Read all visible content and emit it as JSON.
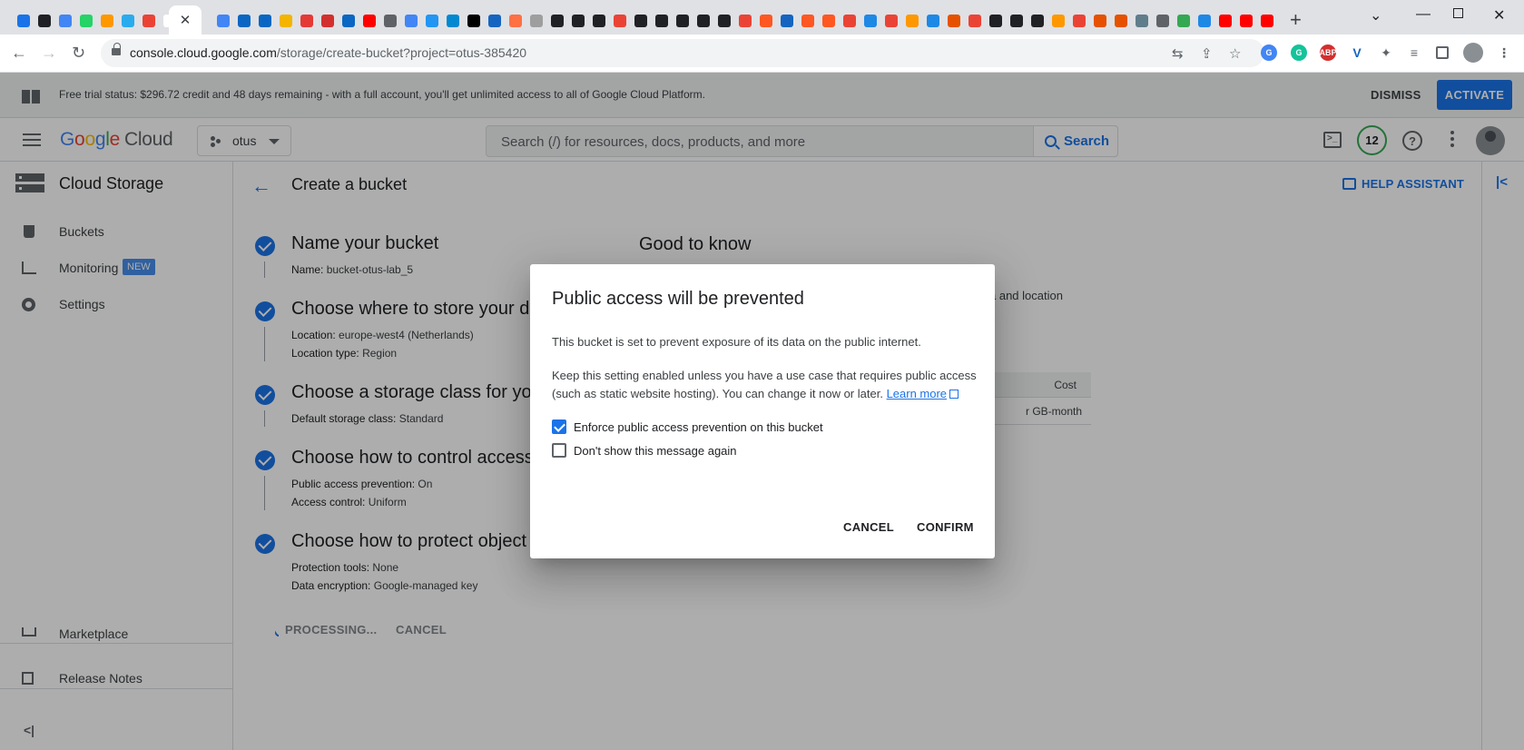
{
  "browser": {
    "active_tab_close": "✕",
    "new_tab": "+",
    "url_host": "console.cloud.google.com",
    "url_path": "/storage/create-bucket?project=otus-385420",
    "favicon_colors": [
      "#1a73e8",
      "#202124",
      "#4285f4",
      "#25d366",
      "#ff9800",
      "#2aabee",
      "#ea4335",
      "#ffffff",
      "#4285f4",
      "#0a66c2",
      "#0a66c2",
      "#f4b400",
      "#e53935",
      "#d32f2f",
      "#0a66c2",
      "#ff0000",
      "#5f6368",
      "#4285f4",
      "#2196f3",
      "#0288d1",
      "#000000",
      "#1565c0",
      "#ff7043",
      "#9e9e9e",
      "#202124",
      "#202124",
      "#202124",
      "#ea4335",
      "#202124",
      "#202124",
      "#202124",
      "#202124",
      "#202124",
      "#ea4335",
      "#ff5722",
      "#1565c0",
      "#ff5722",
      "#ff5722",
      "#ea4335",
      "#1e88e5",
      "#ea4335",
      "#ff9800",
      "#1e88e5",
      "#e65100",
      "#ea4335",
      "#202124",
      "#202124",
      "#202124",
      "#ff9800",
      "#ea4335",
      "#e65100",
      "#e65100",
      "#607d8b",
      "#5f6368",
      "#34a853",
      "#1e88e5",
      "#ff0000",
      "#ff0000",
      "#ff0000"
    ]
  },
  "banner": {
    "text": "Free trial status: $296.72 credit and 48 days remaining - with a full account, you'll get unlimited access to all of Google Cloud Platform.",
    "dismiss": "DISMISS",
    "activate": "ACTIVATE"
  },
  "topbar": {
    "logo_letters": [
      "G",
      "o",
      "o",
      "g",
      "l",
      "e"
    ],
    "logo_suffix": "Cloud",
    "project": "otus",
    "search_placeholder": "Search (/) for resources, docs, products, and more",
    "search_button": "Search",
    "notifications": "12",
    "help": "?"
  },
  "sidebar": {
    "title": "Cloud Storage",
    "items": [
      {
        "label": "Buckets"
      },
      {
        "label": "Monitoring",
        "badge": "NEW"
      },
      {
        "label": "Settings"
      }
    ],
    "bottom": [
      {
        "label": "Marketplace"
      },
      {
        "label": "Release Notes"
      }
    ],
    "collapse": "<|"
  },
  "main": {
    "title": "Create a bucket",
    "help_assistant": "HELP ASSISTANT",
    "steps": [
      {
        "title": "Name your bucket",
        "details": [
          {
            "k": "Name:",
            "v": "bucket-otus-lab_5"
          }
        ]
      },
      {
        "title": "Choose where to store your data",
        "details": [
          {
            "k": "Location:",
            "v": "europe-west4 (Netherlands)"
          },
          {
            "k": "Location type:",
            "v": "Region"
          }
        ]
      },
      {
        "title": "Choose a storage class for your data",
        "details": [
          {
            "k": "Default storage class:",
            "v": "Standard"
          }
        ]
      },
      {
        "title": "Choose how to control access to objects",
        "details": [
          {
            "k": "Public access prevention:",
            "v": "On"
          },
          {
            "k": "Access control:",
            "v": "Uniform"
          }
        ]
      },
      {
        "title": "Choose how to protect object data",
        "details": [
          {
            "k": "Protection tools:",
            "v": "None"
          },
          {
            "k": "Data encryption:",
            "v": "Google-managed key"
          }
        ]
      }
    ],
    "processing": "PROCESSING...",
    "cancel": "CANCEL",
    "good_to_know": {
      "title": "Good to know",
      "text_fragment": "a and location",
      "table_header": "Cost",
      "table_cell": "r GB-month"
    }
  },
  "dialog": {
    "title": "Public access will be prevented",
    "p1": "This bucket is set to prevent exposure of its data on the public internet.",
    "p2": "Keep this setting enabled unless you have a use case that requires public access (such as static website hosting). You can change it now or later.",
    "learn_more": "Learn more",
    "checkbox1": {
      "label": "Enforce public access prevention on this bucket",
      "checked": true
    },
    "checkbox2": {
      "label": "Don't show this message again",
      "checked": false
    },
    "cancel": "CANCEL",
    "confirm": "CONFIRM"
  }
}
